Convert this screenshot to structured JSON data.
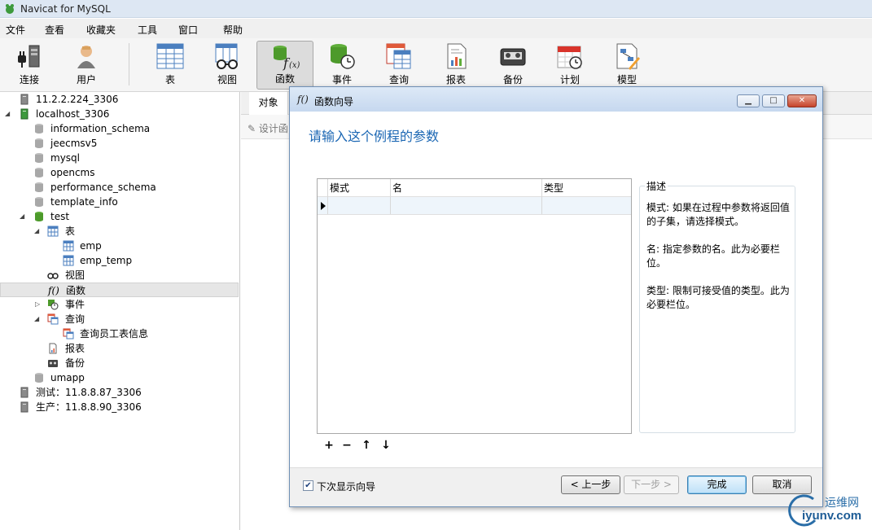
{
  "window": {
    "title": "Navicat for MySQL"
  },
  "menu": [
    "文件",
    "查看",
    "收藏夹",
    "工具",
    "窗口",
    "帮助"
  ],
  "toolbar": {
    "connect": "连接",
    "user": "用户",
    "table": "表",
    "view": "视图",
    "function": "函数",
    "event": "事件",
    "query": "查询",
    "report": "报表",
    "backup": "备份",
    "schedule": "计划",
    "model": "模型"
  },
  "tree": {
    "conn1": "11.2.2.224_3306",
    "conn2": "localhost_3306",
    "db_information_schema": "information_schema",
    "db_jeecmsv5": "jeecmsv5",
    "db_mysql": "mysql",
    "db_opencms": "opencms",
    "db_performance_schema": "performance_schema",
    "db_template_info": "template_info",
    "db_test": "test",
    "tables": "表",
    "table_emp": "emp",
    "table_emp_temp": "emp_temp",
    "views": "视图",
    "functions": "函数",
    "events": "事件",
    "queries": "查询",
    "query1": "查询员工表信息",
    "reports": "报表",
    "backups": "备份",
    "db_umapp": "umapp",
    "conn3": "测试：11.8.8.87_3306",
    "conn4": "生产：11.8.8.90_3306"
  },
  "objects_tab": "对象",
  "design_button": "设计函",
  "dialog": {
    "title": "函数向导",
    "heading": "请输入这个例程的参数",
    "columns": [
      "模式",
      "名",
      "类型"
    ],
    "description_title": "描述",
    "description": [
      "模式: 如果在过程中参数将返回值的子集，请选择模式。",
      "名: 指定参数的名。此为必要栏位。",
      "类型: 限制可接受值的类型。此为必要栏位。"
    ],
    "show_next_time": "下次显示向导",
    "back": "< 上一步",
    "next": "下一步 >",
    "finish": "完成",
    "cancel": "取消"
  },
  "watermark": {
    "line1": "运维网",
    "line2": "iyunv.com"
  }
}
